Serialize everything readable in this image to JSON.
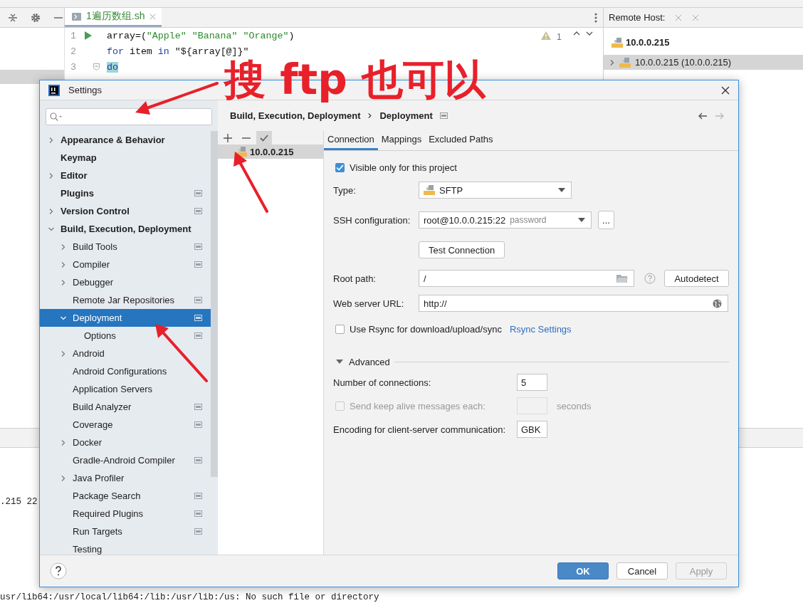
{
  "ide": {
    "editor_tab": {
      "title": "1遍历数组.sh",
      "selected": true
    },
    "inspection_count": "1",
    "code_lines": [
      {
        "number": "1",
        "run": true,
        "fold": false,
        "tokens": [
          {
            "kind": "plain",
            "text": "array=("
          },
          {
            "kind": "string",
            "text": "\"Apple\" "
          },
          {
            "kind": "string",
            "text": "\"Banana\" "
          },
          {
            "kind": "string",
            "text": "\"Orange\""
          },
          {
            "kind": "plain",
            "text": ")"
          }
        ]
      },
      {
        "number": "2",
        "run": false,
        "fold": false,
        "tokens": [
          {
            "kind": "keyword",
            "text": "for"
          },
          {
            "kind": "plain",
            "text": " item "
          },
          {
            "kind": "keyword",
            "text": "in"
          },
          {
            "kind": "plain",
            "text": " \"${array[@]}\""
          }
        ]
      },
      {
        "number": "3",
        "run": false,
        "fold": true,
        "tokens": [
          {
            "kind": "match",
            "text": "do"
          }
        ]
      }
    ],
    "remote_host": {
      "title": "Remote Host:",
      "server": "10.0.0.215",
      "hosts": [
        {
          "name": "10.0.0.215 (10.0.0.215)",
          "selected": true
        }
      ]
    },
    "console_lines": [
      ".215 22",
      "usr/lib64:/usr/local/lib64:/lib:/usr/lib:/us: No such file or directory"
    ]
  },
  "annotation": {
    "text": "搜 ftp 也可以"
  },
  "settings": {
    "title": "Settings",
    "tree": [
      {
        "label": "Appearance & Behavior",
        "expanded": false,
        "selected": false,
        "panel": false
      },
      {
        "label": "Keymap",
        "selected": false,
        "panel": false
      },
      {
        "label": "Editor",
        "expanded": false,
        "selected": false,
        "panel": false
      },
      {
        "label": "Plugins",
        "selected": false,
        "panel": true
      },
      {
        "label": "Version Control",
        "expanded": false,
        "selected": false,
        "panel": true
      },
      {
        "label": "Build, Execution, Deployment",
        "expanded": true,
        "selected": false,
        "panel": false,
        "children": [
          {
            "label": "Build Tools",
            "expanded": false,
            "selected": false,
            "panel": true
          },
          {
            "label": "Compiler",
            "expanded": false,
            "selected": false,
            "panel": true
          },
          {
            "label": "Debugger",
            "expanded": false,
            "selected": false,
            "panel": false
          },
          {
            "label": "Remote Jar Repositories",
            "selected": false,
            "panel": true
          },
          {
            "label": "Deployment",
            "expanded": true,
            "selected": true,
            "panel": true,
            "children": [
              {
                "label": "Options",
                "selected": false,
                "panel": true
              }
            ]
          },
          {
            "label": "Android",
            "expanded": false,
            "selected": false,
            "panel": false
          },
          {
            "label": "Android Configurations",
            "selected": false,
            "panel": false
          },
          {
            "label": "Application Servers",
            "selected": false,
            "panel": false
          },
          {
            "label": "Build Analyzer",
            "selected": false,
            "panel": true
          },
          {
            "label": "Coverage",
            "selected": false,
            "panel": true
          },
          {
            "label": "Docker",
            "expanded": false,
            "selected": false,
            "panel": false
          },
          {
            "label": "Gradle-Android Compiler",
            "selected": false,
            "panel": true
          },
          {
            "label": "Java Profiler",
            "expanded": false,
            "selected": false,
            "panel": false
          },
          {
            "label": "Package Search",
            "selected": false,
            "panel": true
          },
          {
            "label": "Required Plugins",
            "selected": false,
            "panel": true
          },
          {
            "label": "Run Targets",
            "selected": false,
            "panel": true
          },
          {
            "label": "Testing",
            "selected": false,
            "panel": false
          }
        ]
      }
    ],
    "breadcrumb": [
      "Build, Execution, Deployment",
      "Deployment"
    ],
    "servers": [
      {
        "name": "10.0.0.215",
        "selected": true
      }
    ],
    "tabs": [
      {
        "label": "Connection",
        "selected": true
      },
      {
        "label": "Mappings",
        "selected": false
      },
      {
        "label": "Excluded Paths",
        "selected": false
      }
    ],
    "visible_only": {
      "label": "Visible only for this project",
      "checked": true
    },
    "type": {
      "label": "Type:",
      "value": "SFTP"
    },
    "ssh": {
      "label": "SSH configuration:",
      "value": "root@10.0.0.215:22",
      "hint": "password",
      "more": "..."
    },
    "test_button": "Test Connection",
    "root_path": {
      "label": "Root path:",
      "value": "/",
      "button": "Autodetect"
    },
    "web_url": {
      "label": "Web server URL:",
      "value": "http://"
    },
    "rsync": {
      "label": "Use Rsync for download/upload/sync",
      "checked": false,
      "link": "Rsync Settings"
    },
    "advanced": {
      "label": "Advanced",
      "expanded": true
    },
    "connections": {
      "label": "Number of connections:",
      "value": "5"
    },
    "keep_alive": {
      "label": "Send keep alive messages each:",
      "checked": false,
      "disabled": true,
      "unit": "seconds"
    },
    "encoding": {
      "label": "Encoding for client-server communication:",
      "value": "GBK"
    },
    "buttons": [
      {
        "label": "OK",
        "kind": "primary",
        "disabled": false
      },
      {
        "label": "Cancel",
        "kind": "normal",
        "disabled": false
      },
      {
        "label": "Apply",
        "kind": "normal",
        "disabled": true
      }
    ]
  }
}
